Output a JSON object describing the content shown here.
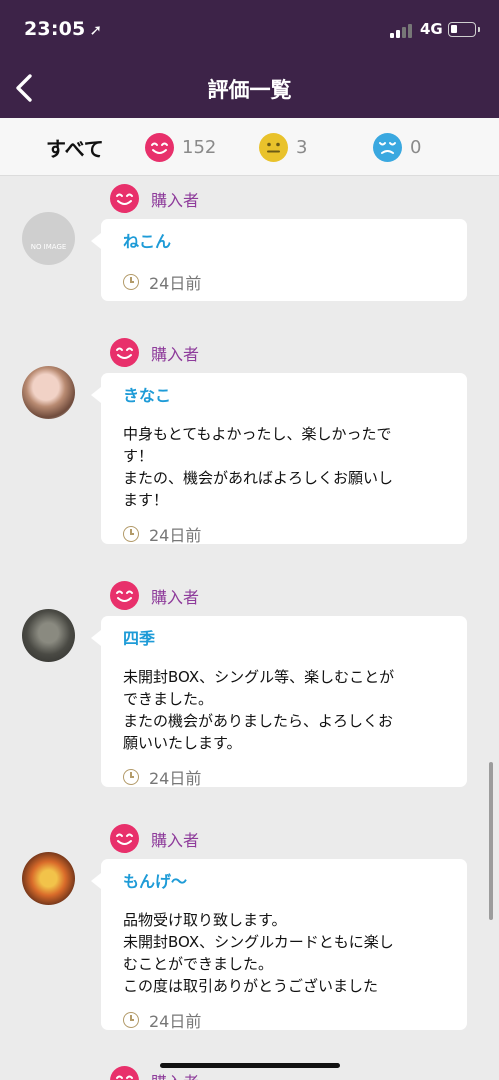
{
  "status_bar": {
    "time": "23:05",
    "location_glyph": "➚",
    "network": "4G"
  },
  "header": {
    "title": "評価一覧"
  },
  "filter": {
    "all_label": "すべて",
    "items": [
      {
        "type": "good",
        "count": "152",
        "color": "#e8306b"
      },
      {
        "type": "neutral",
        "count": "3",
        "color": "#e9c22b"
      },
      {
        "type": "bad",
        "count": "0",
        "color": "#3aa8e0"
      }
    ]
  },
  "reviews": [
    {
      "role": "購入者",
      "name": "ねこん",
      "avatar": "NO IMAGE",
      "comment": [],
      "time": "24日前"
    },
    {
      "role": "購入者",
      "name": "きなこ",
      "avatar": "",
      "comment": [
        "中身もとてもよかったし、楽しかったで",
        "す！",
        "またの、機会があればよろしくお願いし",
        "ます！"
      ],
      "time": "24日前"
    },
    {
      "role": "購入者",
      "name": "四季",
      "avatar": "",
      "comment": [
        "未開封BOX、シングル等、楽しむことが",
        "できました。",
        "またの機会がありましたら、よろしくお",
        "願いいたします。"
      ],
      "time": "24日前"
    },
    {
      "role": "購入者",
      "name": "もんげ～",
      "avatar": "",
      "comment": [
        "品物受け取り致します。",
        "未開封BOX、シングルカードともに楽し",
        "むことができました。",
        "この度は取引ありがとうございました"
      ],
      "time": "24日前"
    },
    {
      "role": "購入者"
    }
  ]
}
